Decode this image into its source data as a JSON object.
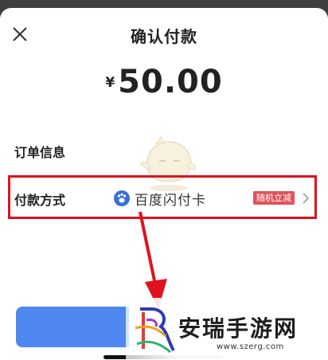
{
  "header": {
    "title": "确认付款",
    "close_icon": "close-icon"
  },
  "payment": {
    "currency_symbol": "¥",
    "amount": "50.00"
  },
  "order": {
    "label": "订单信息"
  },
  "pay_method": {
    "label": "付款方式",
    "icon": "baidu-paw-icon",
    "method_name": "百度闪付卡",
    "promo_badge": "随机立减",
    "chevron_icon": "chevron-right-icon"
  },
  "colors": {
    "accent_blue": "#4e87f0",
    "highlight_red": "#e0121d",
    "badge_red": "#e2525b"
  },
  "watermark": {
    "title": "安瑞手游网",
    "url": "www.szerg.com"
  }
}
